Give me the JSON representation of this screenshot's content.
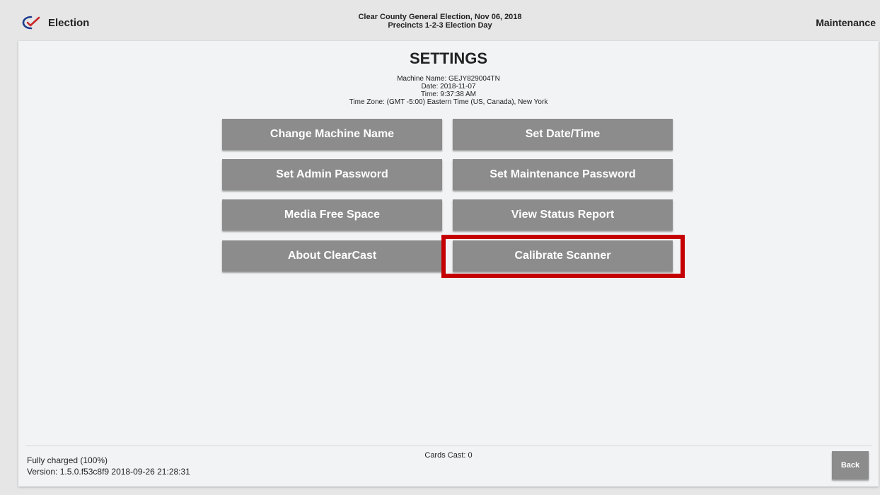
{
  "header": {
    "brand_label": "Election",
    "election_name": "Clear County General Election, Nov 06, 2018",
    "precinct_line": "Precincts 1-2-3 Election Day",
    "mode_label": "Maintenance"
  },
  "settings": {
    "title": "SETTINGS",
    "machine_name": "Machine Name: GEJY829004TN",
    "date": "Date: 2018-11-07",
    "time": "Time: 9:37:38 AM",
    "time_zone": "Time Zone: (GMT -5:00) Eastern Time (US, Canada), New York",
    "buttons": {
      "change_machine_name": "Change Machine Name",
      "set_date_time": "Set Date/Time",
      "set_admin_password": "Set Admin Password",
      "set_maintenance_password": "Set Maintenance Password",
      "media_free_space": "Media Free Space",
      "view_status_report": "View Status Report",
      "about_clearcast": "About ClearCast",
      "calibrate_scanner": "Calibrate Scanner"
    }
  },
  "footer": {
    "battery": "Fully charged (100%)",
    "version": "Version: 1.5.0.f53c8f9 2018-09-26 21:28:31",
    "cards_cast": "Cards Cast: 0",
    "back_label": "Back"
  },
  "colors": {
    "button_bg": "#8c8c8c",
    "highlight": "#c40000",
    "panel_bg": "#f2f3f5",
    "logo_blue": "#1f3d8c",
    "logo_red": "#c62828"
  },
  "icons": {
    "brand": "clearballot-check-logo-icon"
  }
}
